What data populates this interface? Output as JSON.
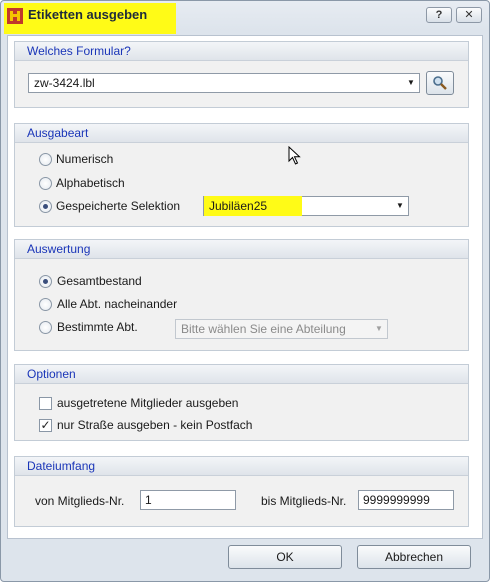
{
  "window": {
    "title": "Etiketten ausgeben",
    "help_button": "?",
    "close_button": "✕"
  },
  "formular": {
    "header": "Welches Formular?",
    "value": "zw-3424.lbl"
  },
  "ausgabeart": {
    "header": "Ausgabeart",
    "options": [
      "Numerisch",
      "Alphabetisch",
      "Gespeicherte Selektion"
    ],
    "selected_index": 2,
    "selection_value": "Jubiläen25"
  },
  "auswertung": {
    "header": "Auswertung",
    "options": [
      "Gesamtbestand",
      "Alle Abt. nacheinander",
      "Bestimmte Abt."
    ],
    "selected_index": 0,
    "abteilung_placeholder": "Bitte wählen Sie eine Abteilung"
  },
  "optionen": {
    "header": "Optionen",
    "items": [
      {
        "label": "ausgetretene Mitglieder ausgeben",
        "checked": false
      },
      {
        "label": "nur Straße ausgeben - kein Postfach",
        "checked": true
      }
    ]
  },
  "dateiumfang": {
    "header": "Dateiumfang",
    "from_label": "von Mitglieds-Nr.",
    "from_value": "1",
    "to_label": "bis Mitglieds-Nr.",
    "to_value": "9999999999"
  },
  "buttons": {
    "ok": "OK",
    "cancel": "Abbrechen"
  },
  "colors": {
    "highlight": "#fffb17",
    "group_header_text": "#1a35b8"
  }
}
